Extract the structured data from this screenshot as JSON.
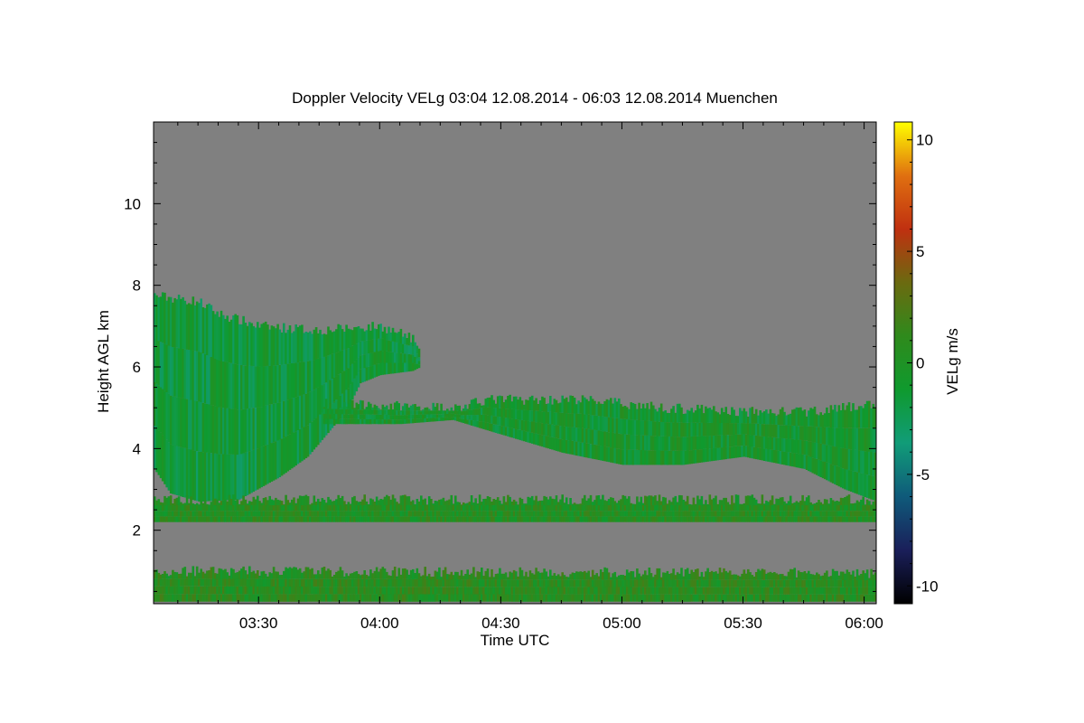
{
  "chart_data": {
    "type": "heatmap",
    "title": "Doppler Velocity VELg   03:04 12.08.2014 - 06:03 12.08.2014 Muenchen",
    "xlabel": "Time UTC",
    "ylabel": "Height AGL km",
    "colorbar_label": "VELg m/s",
    "x_start_min": 184,
    "x_end_min": 363,
    "xlim_label": [
      "03:04",
      "06:03"
    ],
    "ylim": [
      0.2,
      12.0
    ],
    "clim": [
      -10.8,
      10.8
    ],
    "x_ticks": [
      {
        "label": "03:30",
        "minute": 210
      },
      {
        "label": "04:00",
        "minute": 240
      },
      {
        "label": "04:30",
        "minute": 270
      },
      {
        "label": "05:00",
        "minute": 300
      },
      {
        "label": "05:30",
        "minute": 330
      },
      {
        "label": "06:00",
        "minute": 360
      }
    ],
    "y_ticks": [
      {
        "label": "2",
        "value": 2
      },
      {
        "label": "4",
        "value": 4
      },
      {
        "label": "6",
        "value": 6
      },
      {
        "label": "8",
        "value": 8
      },
      {
        "label": "10",
        "value": 10
      }
    ],
    "colorbar_ticks": [
      {
        "label": "10",
        "value": 10
      },
      {
        "label": "5",
        "value": 5
      },
      {
        "label": "0",
        "value": 0
      },
      {
        "label": "-5",
        "value": -5
      },
      {
        "label": "-10",
        "value": -10
      }
    ],
    "no_signal_color": "#808080",
    "colormap": [
      "#000000",
      "#1a1f5a",
      "#0f5a7a",
      "#119c78",
      "#0f9a2e",
      "#2f8a1c",
      "#6b6a10",
      "#c03010",
      "#e07010",
      "#ffff00"
    ],
    "layers": [
      {
        "name": "upper cloud",
        "mean_velocity": -1.5,
        "top_km": [
          [
            184,
            7.75
          ],
          [
            195,
            7.6
          ],
          [
            200,
            7.3
          ],
          [
            210,
            7.0
          ],
          [
            225,
            6.9
          ],
          [
            240,
            7.0
          ],
          [
            248,
            6.7
          ],
          [
            250,
            6.2
          ]
        ],
        "base_km": [
          [
            184,
            3.5
          ],
          [
            188,
            2.9
          ],
          [
            195,
            2.7
          ],
          [
            205,
            2.75
          ],
          [
            215,
            3.3
          ],
          [
            222,
            3.8
          ],
          [
            228,
            4.5
          ],
          [
            232,
            5.0
          ],
          [
            235,
            5.6
          ],
          [
            240,
            5.8
          ],
          [
            248,
            5.9
          ],
          [
            250,
            6.0
          ]
        ]
      },
      {
        "name": "mid cloud",
        "mean_velocity": -0.8,
        "top_km": [
          [
            226,
            5.1
          ],
          [
            260,
            5.0
          ],
          [
            266,
            5.2
          ],
          [
            290,
            5.2
          ],
          [
            310,
            5.0
          ],
          [
            330,
            4.9
          ],
          [
            345,
            4.9
          ],
          [
            355,
            5.0
          ],
          [
            363,
            5.1
          ]
        ],
        "base_km": [
          [
            226,
            4.6
          ],
          [
            245,
            4.6
          ],
          [
            258,
            4.7
          ],
          [
            268,
            4.4
          ],
          [
            285,
            3.9
          ],
          [
            300,
            3.6
          ],
          [
            315,
            3.6
          ],
          [
            330,
            3.8
          ],
          [
            345,
            3.5
          ],
          [
            355,
            3.0
          ],
          [
            363,
            2.7
          ]
        ]
      },
      {
        "name": "boundary layer band",
        "mean_velocity": 0.3,
        "top_km": [
          [
            184,
            2.75
          ],
          [
            363,
            2.75
          ]
        ],
        "base_km": [
          [
            184,
            2.2
          ],
          [
            363,
            2.2
          ]
        ]
      },
      {
        "name": "near-surface layer",
        "mean_velocity": 0.6,
        "top_km": [
          [
            184,
            1.0
          ],
          [
            363,
            0.95
          ]
        ],
        "base_km": [
          [
            184,
            0.25
          ],
          [
            363,
            0.25
          ]
        ]
      }
    ]
  }
}
